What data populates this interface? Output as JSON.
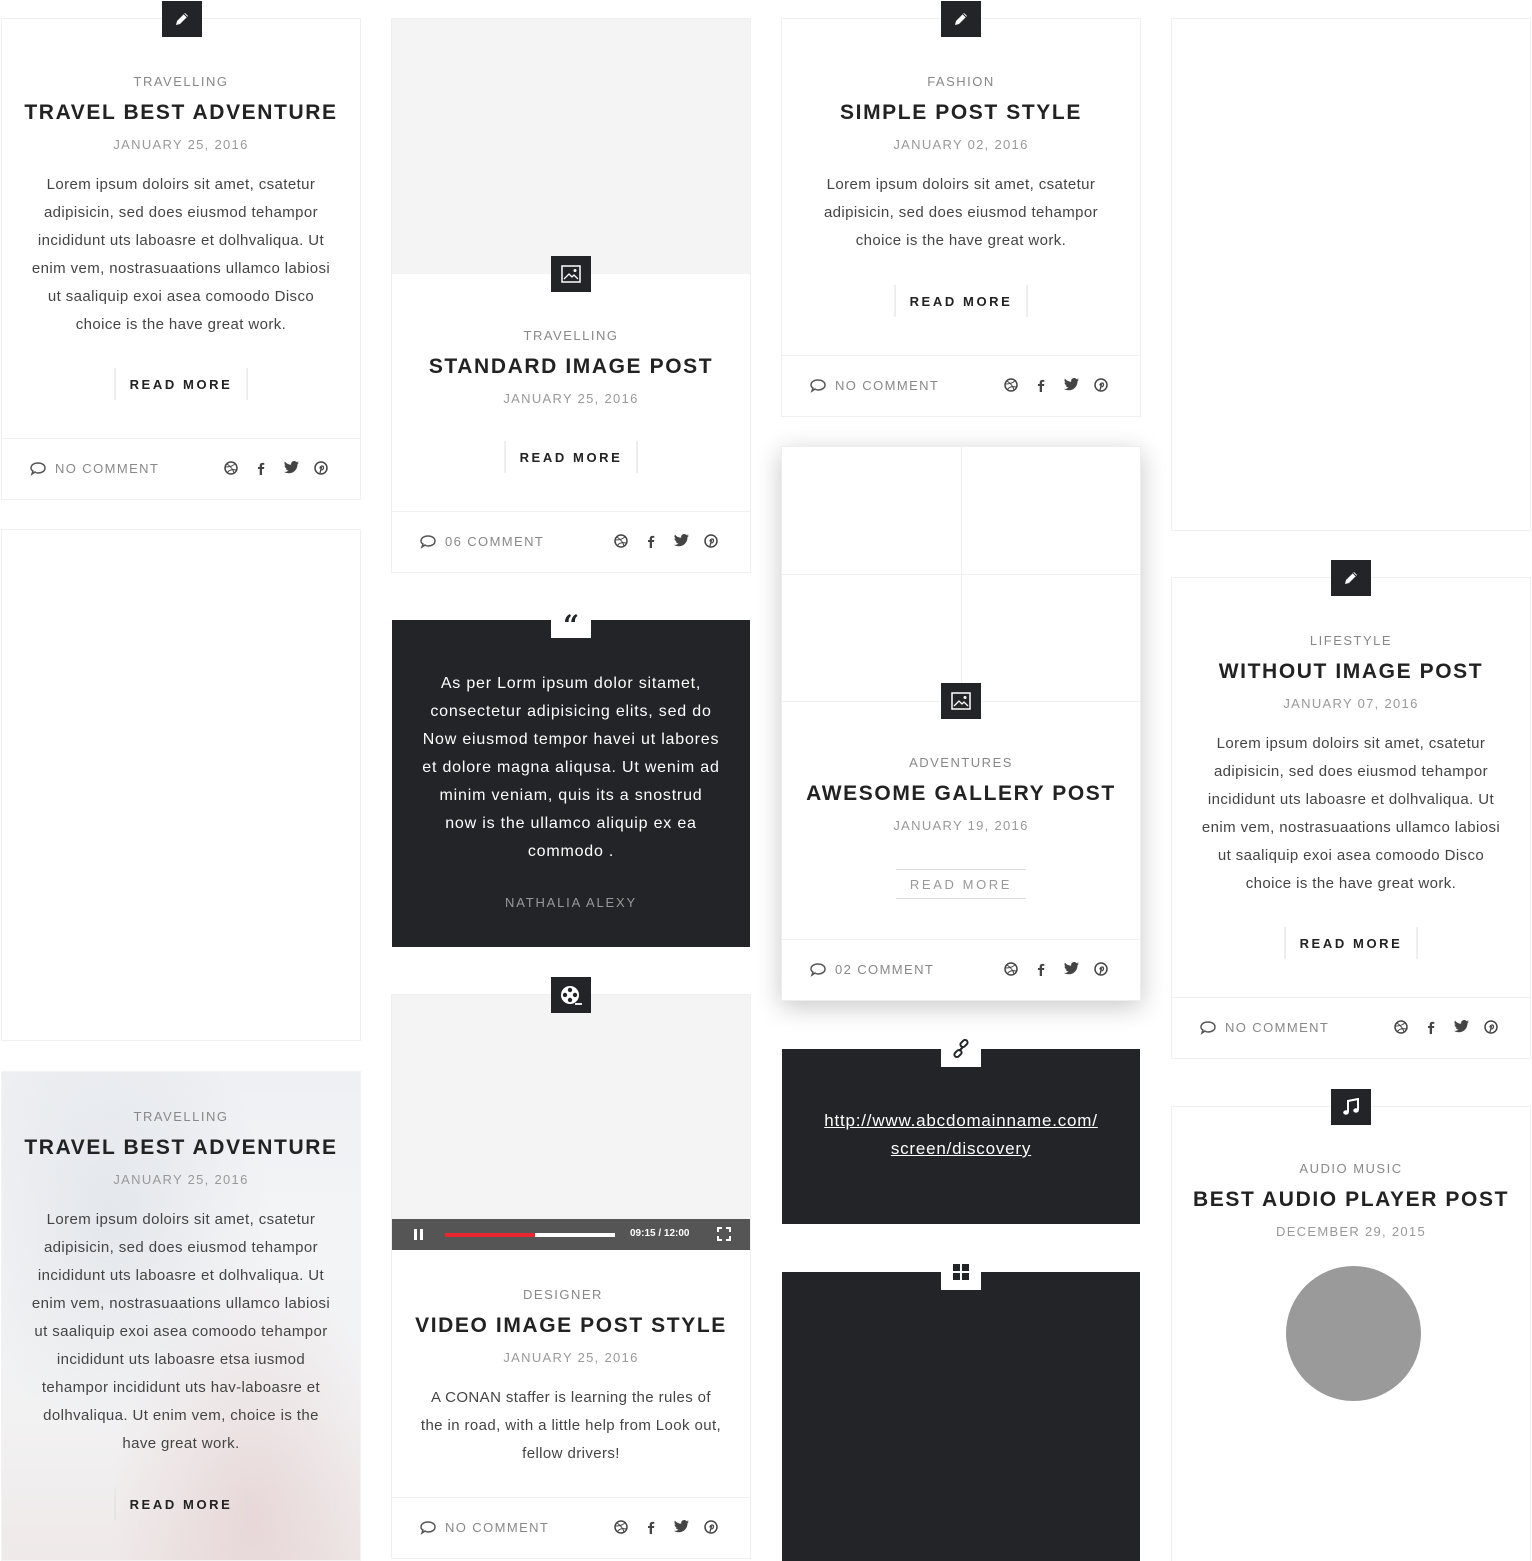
{
  "posts": {
    "travel1": {
      "category": "TRAVELLING",
      "title": "TRAVEL BEST ADVENTURE",
      "date": "JANUARY 25, 2016",
      "excerpt": "Lorem ipsum doloirs sit amet, csatetur adipisicin, sed does eiusmod tehampor incididunt uts laboasre et dolhvaliqua. Ut enim  vem, nostrasuaations ullamco labiosi ut saaliquip exoi asea comoodo Disco choice is the have great work.",
      "read_more": "READ MORE",
      "comments": "NO COMMENT",
      "icon": "pencil-icon"
    },
    "standard": {
      "category": "TRAVELLING",
      "title": "STANDARD IMAGE POST",
      "date": "JANUARY 25, 2016",
      "read_more": "READ MORE",
      "comments": "06 COMMENT",
      "icon": "image-icon"
    },
    "simple": {
      "category": "FASHION",
      "title": "SIMPLE POST STYLE",
      "date": "JANUARY 02, 2016",
      "excerpt": "Lorem ipsum doloirs sit amet, csatetur adipisicin, sed does eiusmod tehampor choice is the have great work.",
      "read_more": "READ MORE",
      "comments": "NO COMMENT",
      "icon": "pencil-icon"
    },
    "quote": {
      "text": "As per Lorm ipsum dolor sitamet, consectetur adipisicing elits, sed do Now eiusmod tempor havei ut labores et dolore magna aliqusa. Ut wenim ad minim veniam, quis its a snostrud now is the ullamco aliquip ex ea commodo .",
      "author": "NATHALIA ALEXY",
      "icon": "quote-icon"
    },
    "gallery": {
      "category": "ADVENTURES",
      "title": "AWESOME GALLERY POST",
      "date": "JANUARY 19, 2016",
      "read_more": "READ MORE",
      "comments": "02 COMMENT",
      "icon": "image-icon"
    },
    "without": {
      "category": "LIFESTYLE",
      "title": "WITHOUT IMAGE POST",
      "date": "JANUARY 07, 2016",
      "excerpt": "Lorem ipsum doloirs sit amet, csatetur adipisicin, sed does eiusmod tehampor incididunt uts laboasre et dolhvaliqua. Ut enim  vem, nostrasuaations ullamco labiosi ut saaliquip exoi asea comoodo Disco choice is the have great work.",
      "read_more": "READ MORE",
      "comments": "NO COMMENT",
      "icon": "pencil-icon"
    },
    "travel2": {
      "category": "TRAVELLING",
      "title": "TRAVEL BEST ADVENTURE",
      "date": "JANUARY 25, 2016",
      "excerpt": "Lorem ipsum doloirs sit amet, csatetur adipisicin, sed does eiusmod tehampor incididunt uts laboasre et dolhvaliqua. Ut enim  vem, nostrasuaations ullamco labiosi ut saaliquip exoi asea comoodo tehampor incididunt uts laboasre etsa iusmod tehampor incididunt uts hav-laboasre et dolhvaliqua. Ut enim  vem, choice is the have great work.",
      "read_more": "READ MORE"
    },
    "video": {
      "category": "DESIGNER",
      "title": "VIDEO IMAGE POST STYLE",
      "date": "JANUARY 25, 2016",
      "excerpt": "A CONAN staffer is learning the rules of the in  road, with a little help from Look out, fellow drivers!",
      "comments": "NO COMMENT",
      "player_time": "09:15 / 12:00",
      "progress": 0.53,
      "icon": "film-reel-icon"
    },
    "link": {
      "url": "http://www.abcdomainname.com/ screen/discovery",
      "icon": "link-icon"
    },
    "grid_post": {
      "icon": "grid-icon"
    },
    "audio": {
      "category": "AUDIO MUSIC",
      "title": "BEST AUDIO PLAYER POST",
      "date": "DECEMBER 29, 2015",
      "icon": "music-note-icon"
    }
  },
  "social_icons": [
    "dribbble-icon",
    "facebook-icon",
    "twitter-icon",
    "pinterest-icon"
  ],
  "colors": {
    "dark": "#222428",
    "accent": "#e8262d",
    "grey_bg": "#f4f4f4"
  }
}
